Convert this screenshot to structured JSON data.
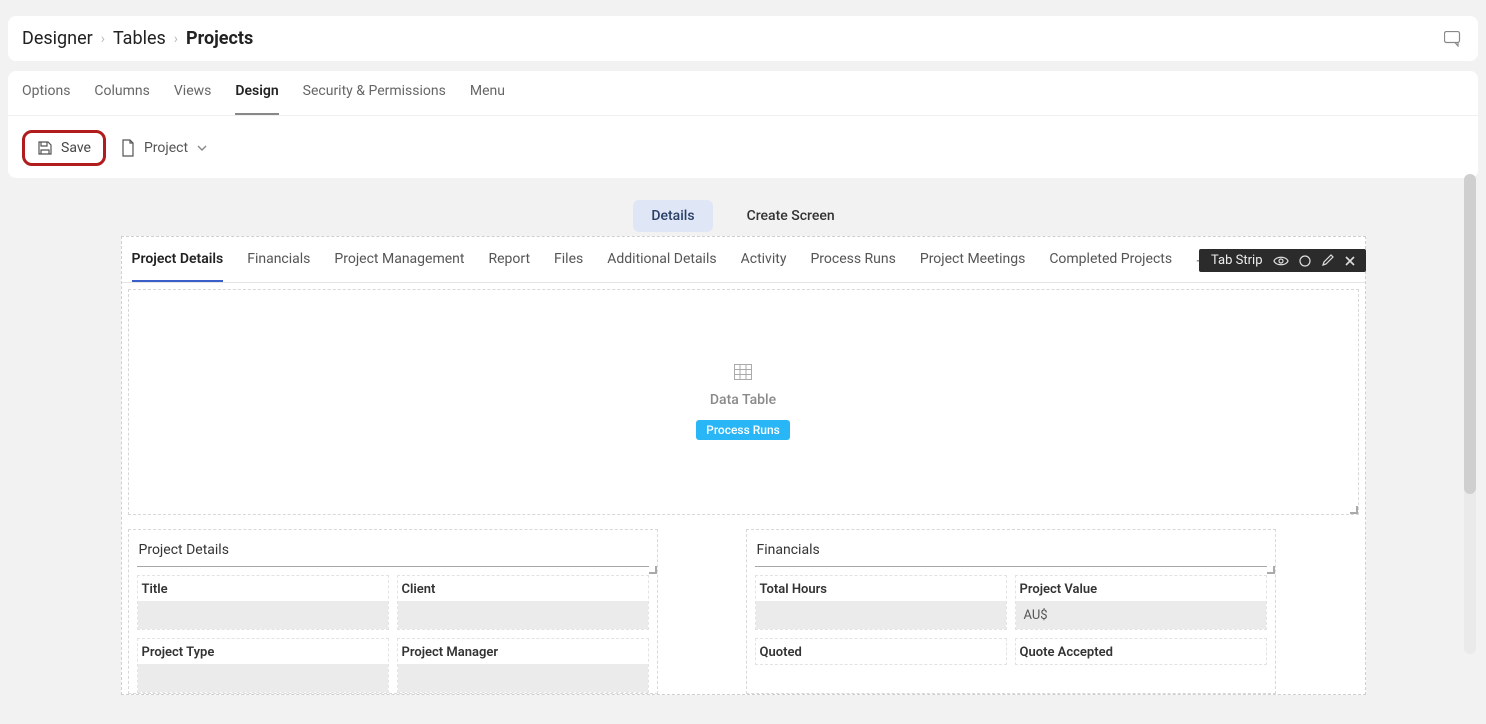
{
  "breadcrumb": {
    "root": "Designer",
    "level1": "Tables",
    "current": "Projects"
  },
  "nav": {
    "options": "Options",
    "columns": "Columns",
    "views": "Views",
    "design": "Design",
    "security": "Security & Permissions",
    "menu": "Menu"
  },
  "toolbar": {
    "save_label": "Save",
    "project_label": "Project"
  },
  "view_tabs": {
    "details": "Details",
    "create_screen": "Create Screen"
  },
  "inner_tabs": {
    "t0": "Project Details",
    "t1": "Financials",
    "t2": "Project Management",
    "t3": "Report",
    "t4": "Files",
    "t5": "Additional Details",
    "t6": "Activity",
    "t7": "Process Runs",
    "t8": "Project Meetings",
    "t9": "Completed Projects"
  },
  "tabstrip_bar": {
    "label": "Tab Strip"
  },
  "datatable": {
    "label": "Data Table",
    "pill": "Process Runs"
  },
  "left_section": {
    "title": "Project Details",
    "fields": {
      "title": "Title",
      "client": "Client",
      "project_type": "Project Type",
      "project_manager": "Project Manager"
    }
  },
  "right_section": {
    "title": "Financials",
    "fields": {
      "total_hours": "Total Hours",
      "project_value": "Project Value",
      "project_value_prefix": "AU$",
      "quoted": "Quoted",
      "quote_accepted": "Quote Accepted"
    }
  }
}
